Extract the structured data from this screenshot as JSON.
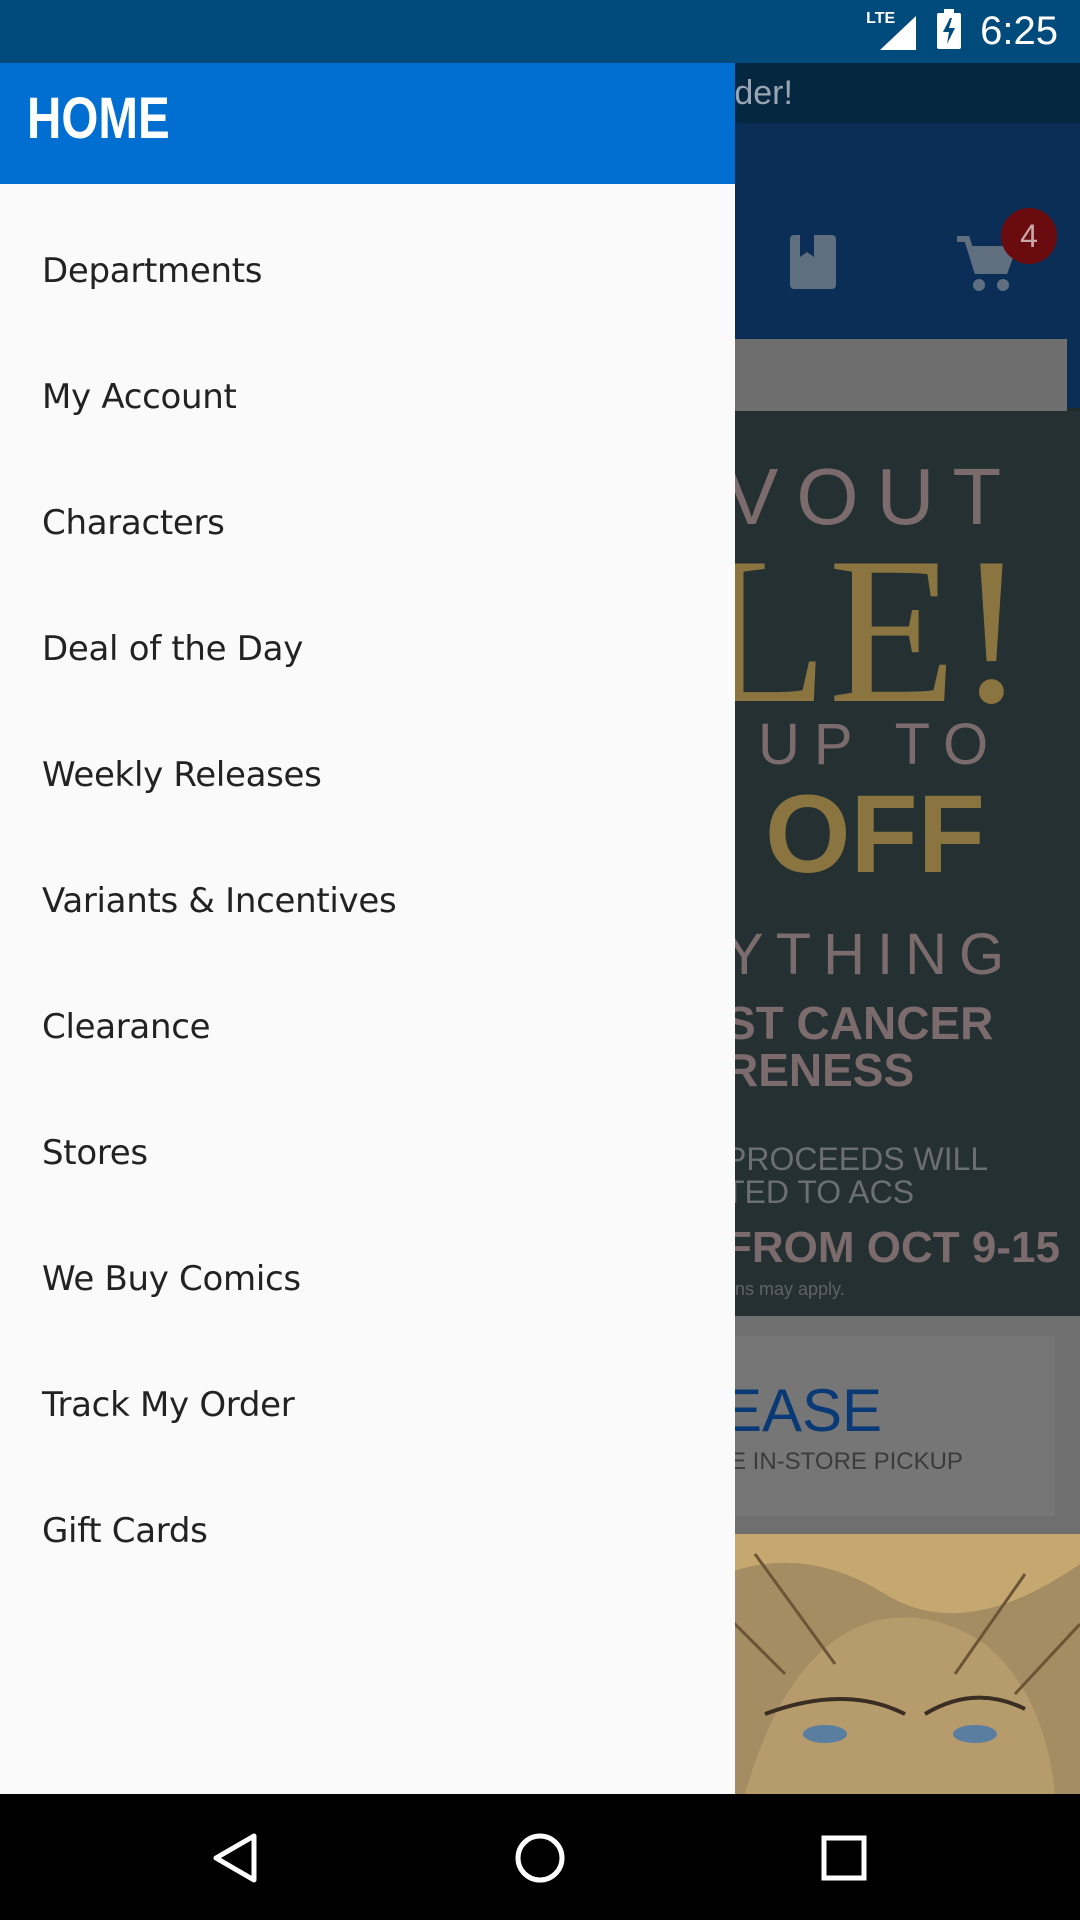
{
  "status_bar": {
    "network": "LTE",
    "time": "6:25"
  },
  "background_app": {
    "promo_text": "rder!",
    "cart_count": "4",
    "banner": {
      "line1": "VOUT",
      "line2": "LE!",
      "line3": "UP TO",
      "line4": "OFF",
      "line5": "YTHING",
      "line6": "ST CANCER",
      "line7": "RENESS",
      "line8": "PROCEEDS WILL",
      "line9": "TED TO ACS",
      "line10": "FROM OCT 9-15",
      "line11": "ons may apply."
    },
    "release": {
      "title": "EASE",
      "subtitle": "E IN-STORE PICKUP"
    }
  },
  "drawer": {
    "title": "HOME",
    "items": [
      {
        "label": "Departments"
      },
      {
        "label": "My Account"
      },
      {
        "label": "Characters"
      },
      {
        "label": "Deal of the Day"
      },
      {
        "label": "Weekly Releases"
      },
      {
        "label": "Variants & Incentives"
      },
      {
        "label": "Clearance"
      },
      {
        "label": "Stores"
      },
      {
        "label": "We Buy Comics"
      },
      {
        "label": "Track My Order"
      },
      {
        "label": "Gift Cards"
      }
    ]
  },
  "nav_bar": {
    "buttons": [
      "back-icon",
      "home-icon",
      "recents-icon"
    ]
  },
  "colors": {
    "status_bar": "#004a7c",
    "drawer_header": "#006fd1",
    "drawer_bg": "#fafafa"
  }
}
